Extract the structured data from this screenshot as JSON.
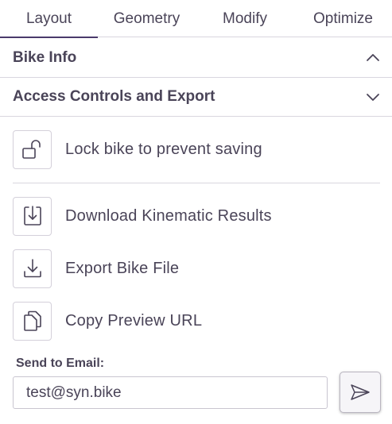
{
  "tabs": [
    {
      "label": "Layout",
      "active": true
    },
    {
      "label": "Geometry",
      "active": false
    },
    {
      "label": "Modify",
      "active": false
    },
    {
      "label": "Optimize",
      "active": false
    }
  ],
  "sections": {
    "bike_info": {
      "title": "Bike Info",
      "expanded": true,
      "chevron": "chevron-up-icon"
    },
    "access": {
      "title": "Access Controls and Export",
      "expanded": false,
      "chevron": "chevron-down-icon"
    }
  },
  "actions": {
    "lock": {
      "label": "Lock bike to prevent saving",
      "icon": "unlock-icon"
    },
    "download": {
      "label": "Download Kinematic Results",
      "icon": "download-file-icon"
    },
    "export": {
      "label": "Export Bike File",
      "icon": "download-icon"
    },
    "copy": {
      "label": "Copy Preview URL",
      "icon": "copy-icon"
    }
  },
  "email": {
    "label": "Send to Email:",
    "value": "test@syn.bike",
    "send_icon": "send-icon"
  },
  "colors": {
    "text": "#4a4458",
    "accent": "#4a3a6b",
    "border": "#d9d6df"
  }
}
